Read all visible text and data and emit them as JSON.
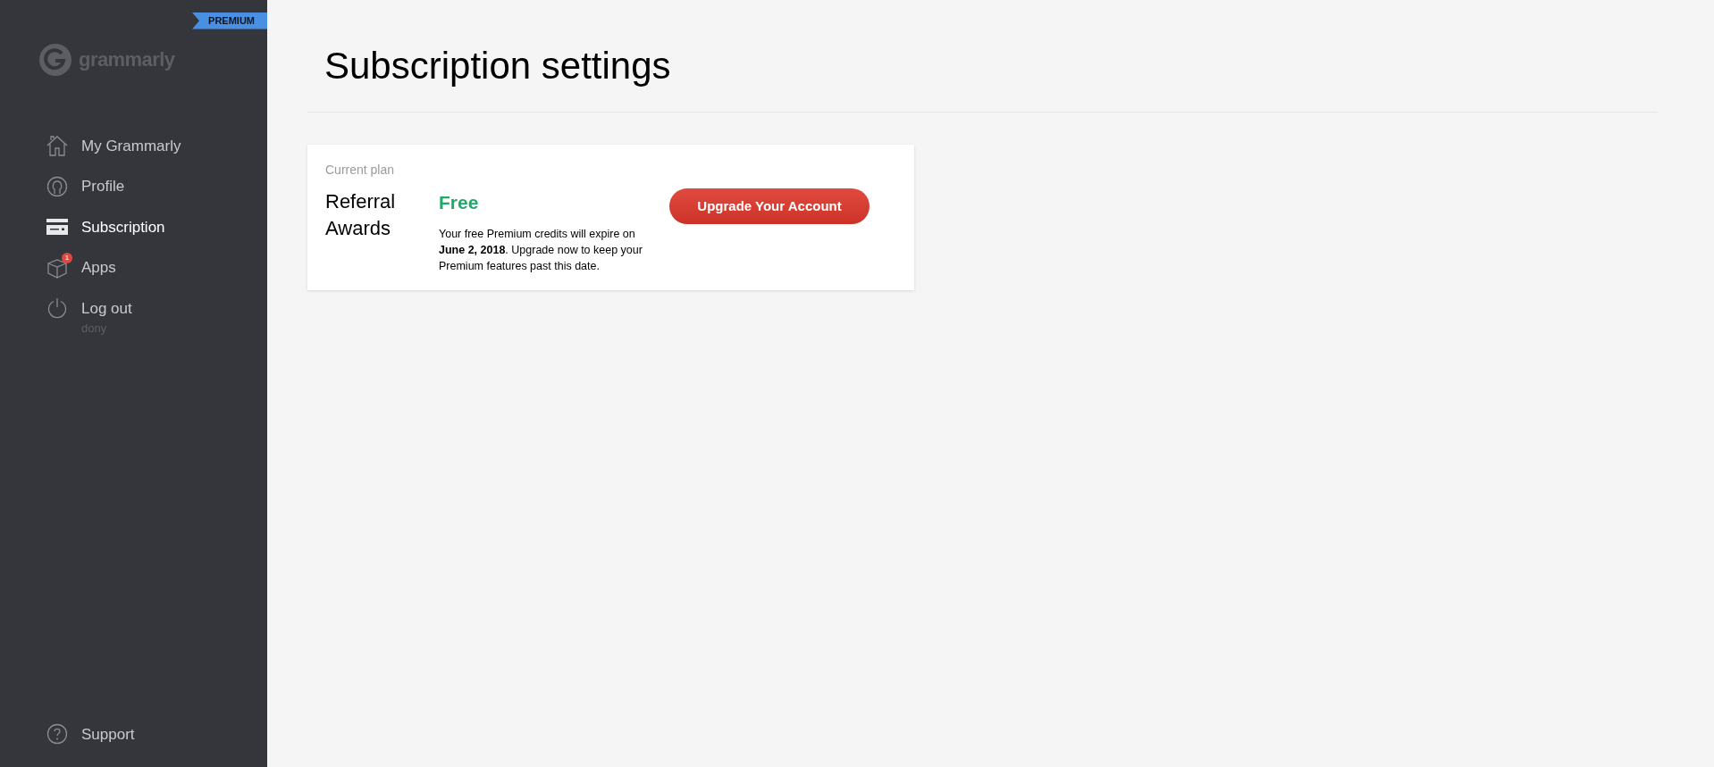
{
  "sidebar": {
    "badge": "PREMIUM",
    "logo": "grammarly",
    "items": [
      {
        "kind": "home",
        "label": "My Grammarly",
        "selected": false
      },
      {
        "kind": "profile",
        "label": "Profile",
        "selected": false
      },
      {
        "kind": "card",
        "label": "Subscription",
        "selected": true
      },
      {
        "kind": "box",
        "label": "Apps",
        "selected": false,
        "count": "1"
      },
      {
        "kind": "power",
        "label": "Log out",
        "selected": false,
        "sub": "dony"
      }
    ],
    "support": {
      "kind": "help",
      "label": "Support"
    }
  },
  "page": {
    "title": "Subscription settings",
    "plan": {
      "heading": "Current plan",
      "name": "Referral Awards",
      "tier": "Free",
      "note": "Your free Premium credits will expire on **June 2, 2018**. Upgrade now to keep your Premium features past this date.",
      "button": "Upgrade Your Account"
    }
  }
}
